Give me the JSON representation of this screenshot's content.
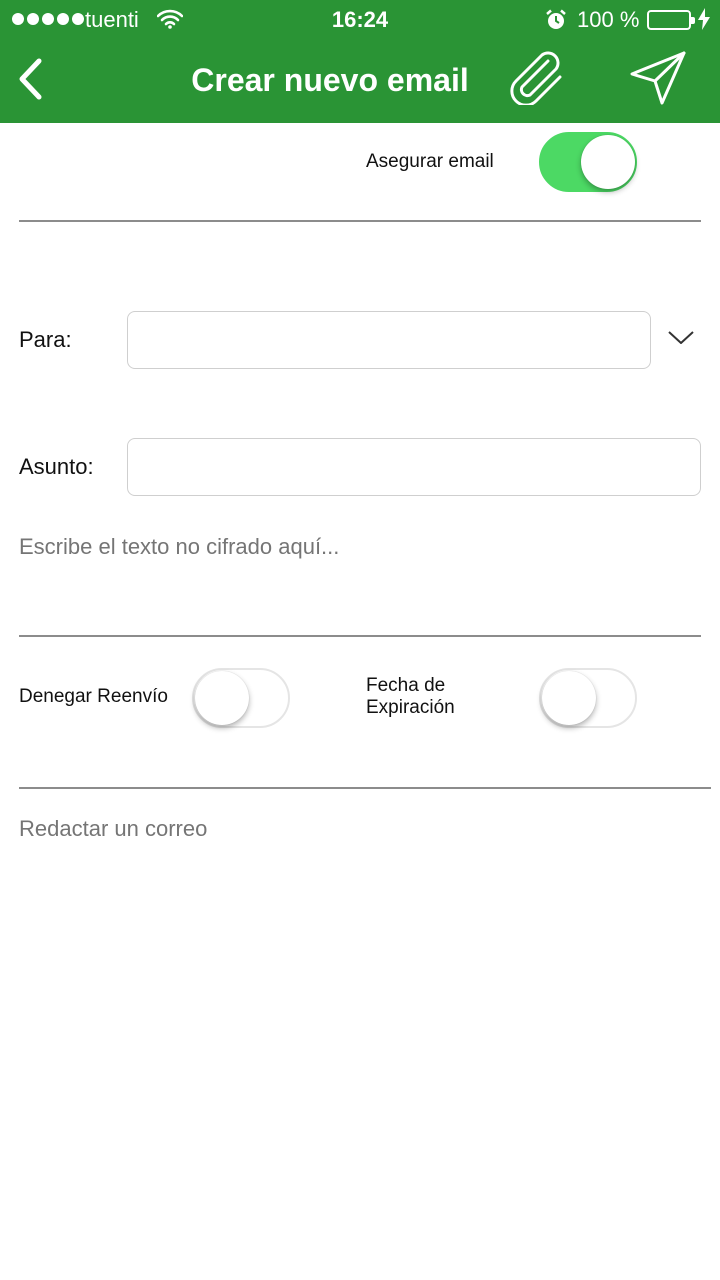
{
  "status_bar": {
    "carrier": "tuenti",
    "time": "16:24",
    "battery_text": "100 %",
    "signal_bars": 5,
    "icons": [
      "signal-dots-icon",
      "wifi-icon",
      "alarm-icon",
      "battery-icon",
      "charging-bolt-icon"
    ]
  },
  "nav": {
    "title": "Crear nuevo email",
    "icons": [
      "back-chevron-icon",
      "paperclip-icon",
      "send-paper-plane-icon"
    ]
  },
  "secure": {
    "label": "Asegurar email",
    "on": true
  },
  "form": {
    "to_label": "Para:",
    "to_value": "",
    "subject_label": "Asunto:",
    "subject_value": "",
    "body_placeholder": "Escribe el texto no cifrado aquí..."
  },
  "options": {
    "deny_forward_label": "Denegar Reenvío",
    "deny_forward_on": false,
    "expiration_label_line1": "Fecha de",
    "expiration_label_line2": "Expiración",
    "expiration_on": false
  },
  "compose": {
    "placeholder": "Redactar un correo"
  },
  "colors": {
    "header_green": "#2a9435",
    "toggle_on": "#4cd964",
    "placeholder_gray": "#8a8a8a"
  }
}
